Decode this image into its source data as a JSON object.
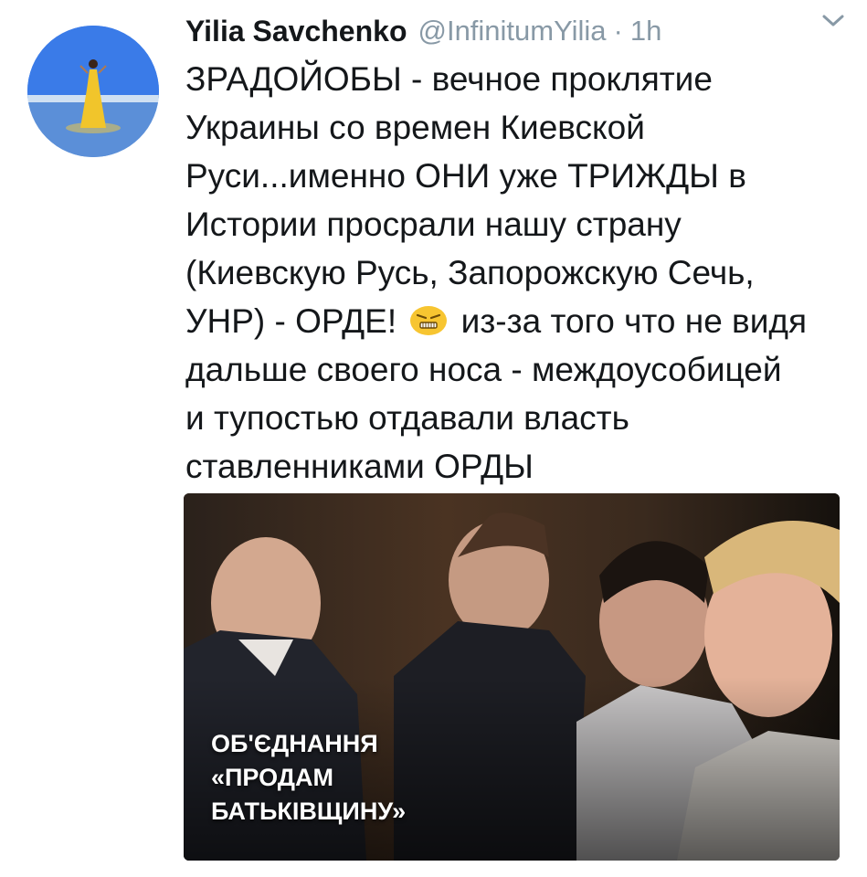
{
  "tweet": {
    "author_name": "Yilia Savchenko",
    "handle": "@InfinitumYilia",
    "separator": "·",
    "time": "1h",
    "lines": [
      "ЗРАДОЙОБЫ - вечное проклятие",
      "Украины со времен Киевской",
      "Руси...именно ОНИ уже ТРИЖДЫ в",
      "Истории просрали нашу страну",
      "(Киевскую Русь, Запорожскую Сечь,",
      "дальше своего носа - междоусобицей",
      "и тупостью отдавали власть",
      "ставленниками ОРДЫ"
    ],
    "line_with_emoji": {
      "before": "УНР) - ОРДЕ!",
      "after": "из-за того что не видя",
      "emoji": "angry-face-emoji"
    },
    "media": {
      "caption_lines": [
        "ОБ'ЄДНАННЯ",
        "«ПРОДАМ",
        "БАТЬКІВЩИНУ»"
      ]
    }
  },
  "icons": {
    "menu": "chevron-down-icon",
    "avatar": "profile-photo"
  },
  "colors": {
    "text": "#14171a",
    "secondary": "#8899a6",
    "emoji": "#f7c531"
  }
}
